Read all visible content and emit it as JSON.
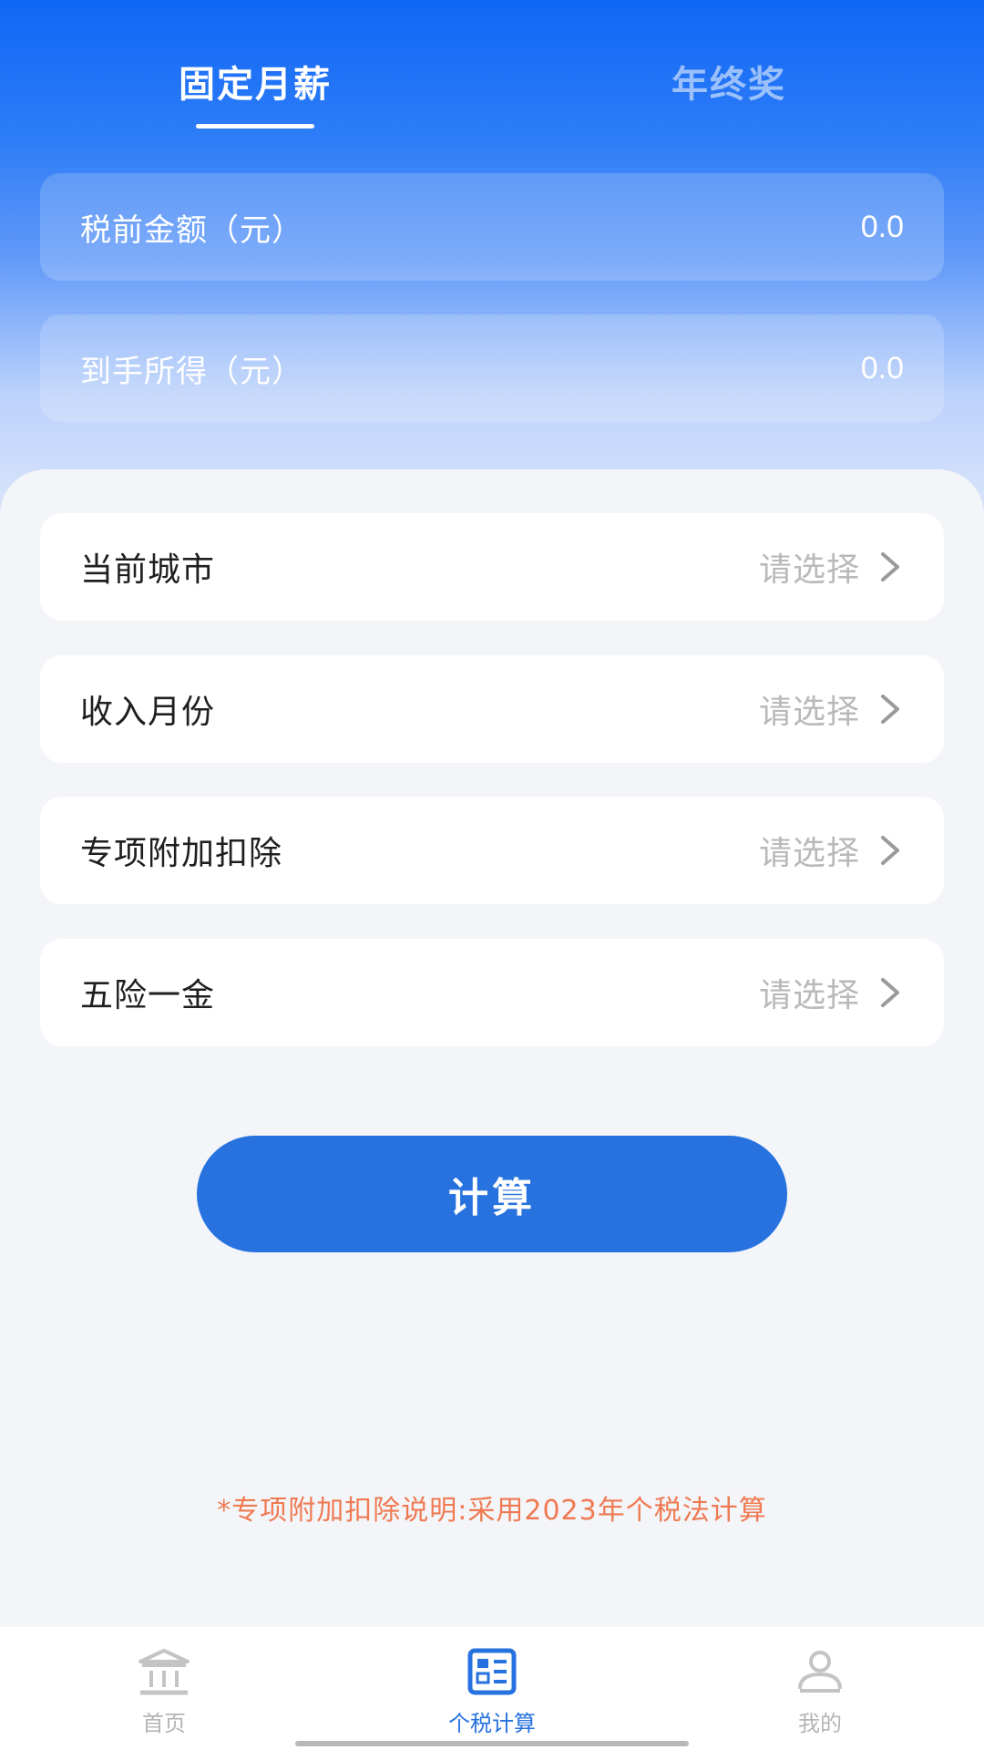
{
  "tabs": [
    {
      "label": "固定月薪",
      "active": true
    },
    {
      "label": "年终奖",
      "active": false
    }
  ],
  "summary": {
    "pretax_label": "税前金额（元）",
    "pretax_value": "0.0",
    "net_label": "到手所得（元）",
    "net_value": "0.0"
  },
  "rows": [
    {
      "label": "当前城市",
      "value": "请选择"
    },
    {
      "label": "收入月份",
      "value": "请选择"
    },
    {
      "label": "专项附加扣除",
      "value": "请选择"
    },
    {
      "label": "五险一金",
      "value": "请选择"
    }
  ],
  "calculate_label": "计算",
  "note": "*专项附加扣除说明:采用2023年个税法计算",
  "nav": [
    {
      "label": "首页",
      "icon": "bank-icon",
      "active": false
    },
    {
      "label": "个税计算",
      "icon": "calculator-icon",
      "active": true
    },
    {
      "label": "我的",
      "icon": "user-icon",
      "active": false
    }
  ],
  "colors": {
    "primary": "#2772df",
    "header_top": "#0f67f6",
    "note": "#ef7a52",
    "placeholder": "#b9b9b9",
    "background": "#f3f5f9"
  }
}
